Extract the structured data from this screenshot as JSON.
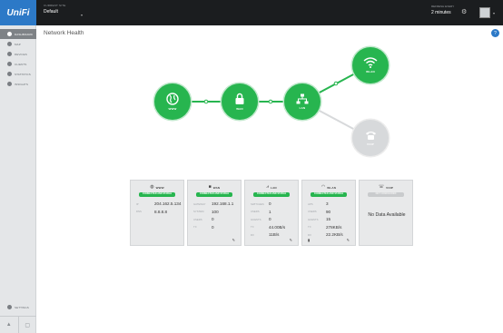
{
  "header": {
    "logo": "UniFi",
    "site_label": "CURRENT SITE",
    "site_value": "Default",
    "refresh_label": "REFRESH EVERY",
    "refresh_value": "2 minutes"
  },
  "sidebar": {
    "items": [
      {
        "label": "DASHBOARD",
        "icon": "dashboard-icon"
      },
      {
        "label": "MAP",
        "icon": "map-icon"
      },
      {
        "label": "DEVICES",
        "icon": "devices-icon"
      },
      {
        "label": "CLIENTS",
        "icon": "clients-icon"
      },
      {
        "label": "STATISTICS",
        "icon": "statistics-icon"
      },
      {
        "label": "INSIGHTS",
        "icon": "insights-icon"
      }
    ],
    "settings_label": "SETTINGS"
  },
  "page": {
    "title": "Network Health",
    "help": "?"
  },
  "nodes": {
    "www": "WWW",
    "wan": "WAN",
    "lan": "LAN",
    "wlan": "WLAN",
    "voip": "VOIP",
    "status_colors": {
      "ok": "#27b54f",
      "inactive": "#d7d9db"
    }
  },
  "cards": [
    {
      "title": "WWW",
      "status": "CONNECTED AND STABLE",
      "rows": [
        {
          "label": "IP",
          "value": "204.162.5.134"
        },
        {
          "label": "DNS",
          "value": "8.8.8.8"
        }
      ]
    },
    {
      "title": "WAN",
      "status": "CONNECTED AND STABLE",
      "rows": [
        {
          "label": "GATEWAY",
          "value": "192.168.1.1"
        },
        {
          "label": "SYSTEM",
          "value": "100"
        },
        {
          "label": "USERS",
          "value": "0"
        },
        {
          "label": "TX",
          "value": "0"
        }
      ]
    },
    {
      "title": "LAN",
      "status": "CONNECTED AND STABLE",
      "rows": [
        {
          "label": "SWITCHES",
          "value": "0"
        },
        {
          "label": "USERS",
          "value": "1"
        },
        {
          "label": "GUESTS",
          "value": "0"
        },
        {
          "label": "TX",
          "value": "44.00B/s"
        },
        {
          "label": "RX",
          "value": "11B/s"
        }
      ]
    },
    {
      "title": "WLAN",
      "status": "CONNECTED AND STABLE",
      "rows": [
        {
          "label": "APS",
          "value": "3"
        },
        {
          "label": "USERS",
          "value": "90"
        },
        {
          "label": "GUESTS",
          "value": "15"
        },
        {
          "label": "TX",
          "value": "278KB/s"
        },
        {
          "label": "RX",
          "value": "22.2KB/s"
        }
      ]
    },
    {
      "title": "VOIP",
      "status": "NOT CONFIGURED",
      "no_data": "No Data Available"
    }
  ]
}
